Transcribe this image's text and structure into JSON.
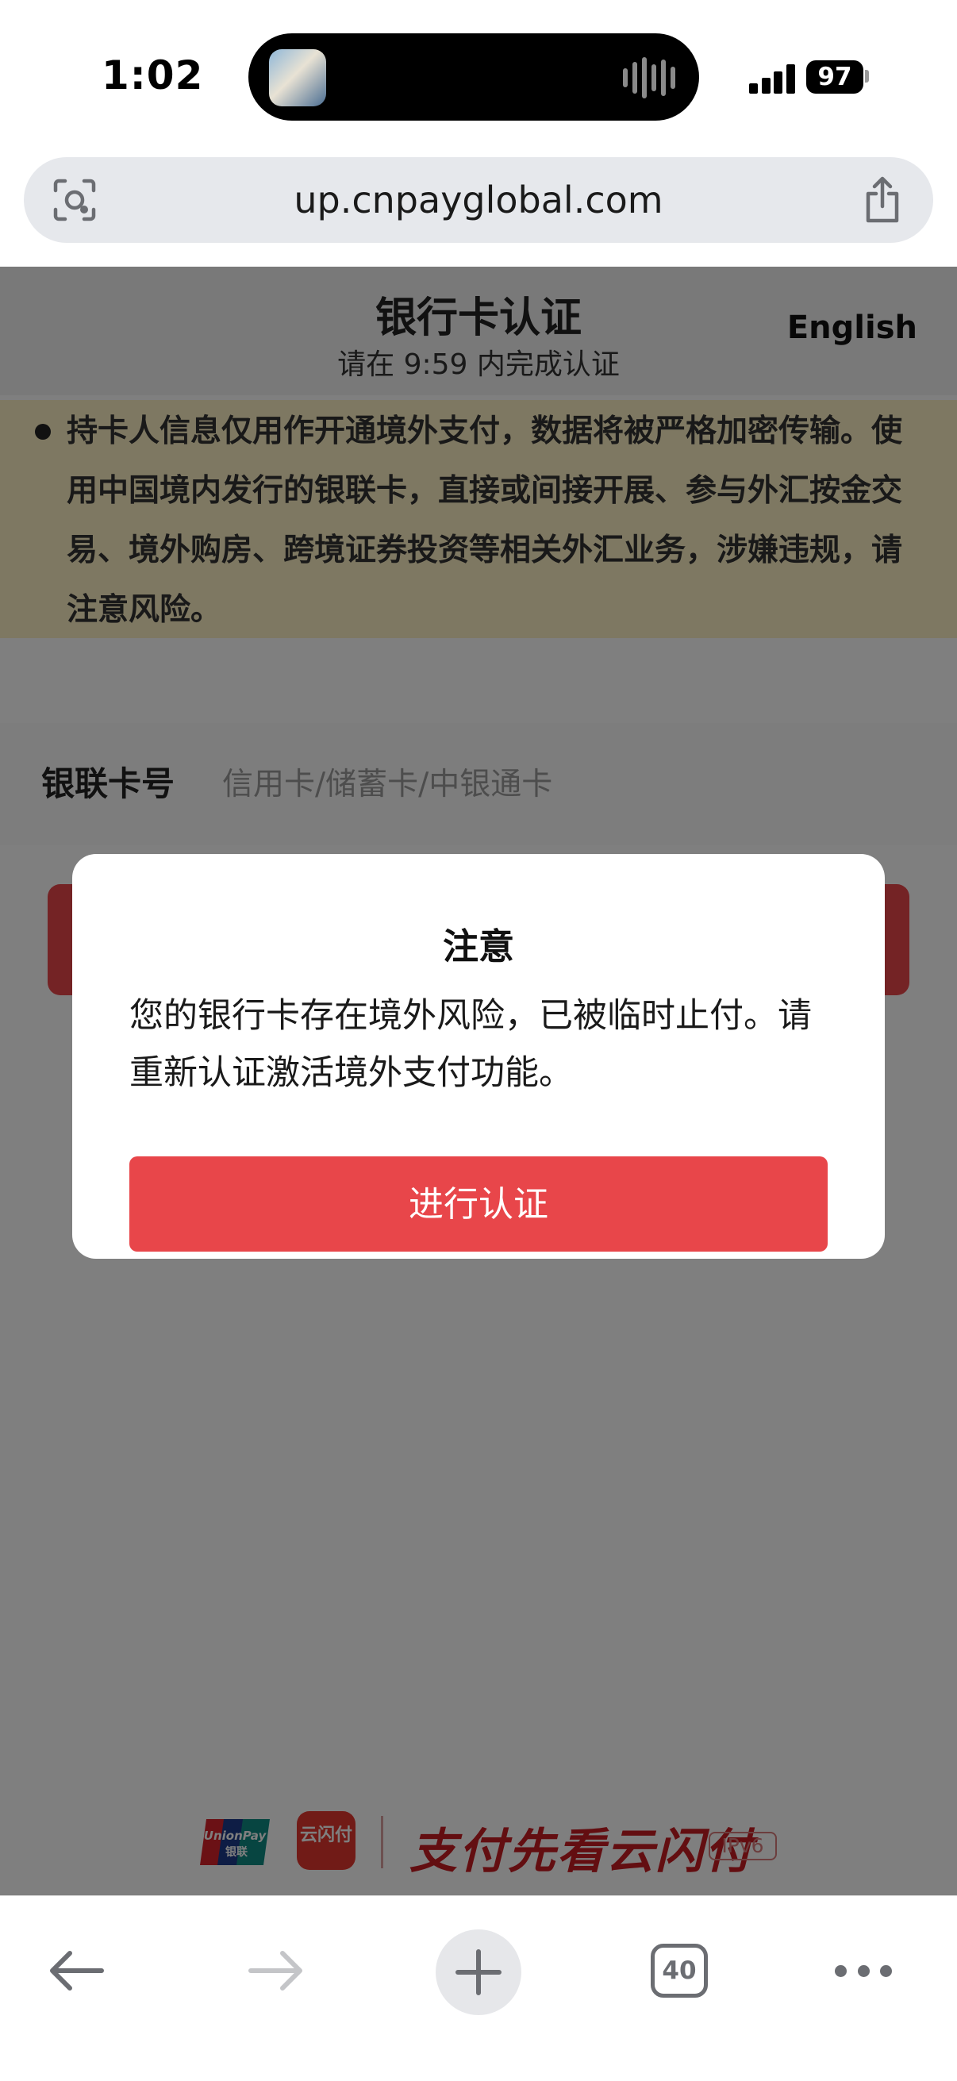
{
  "status_bar": {
    "time": "1:02",
    "battery": "97"
  },
  "browser": {
    "url": "up.cnpayglobal.com",
    "tab_count": "40",
    "icons": {
      "lens": "camera-lens-icon",
      "share": "share-icon",
      "back": "back-arrow-icon",
      "forward": "forward-arrow-icon",
      "new_tab": "plus-icon",
      "tabs": "tabs-icon",
      "more": "more-dots-icon"
    }
  },
  "page": {
    "title": "银行卡认证",
    "subtitle": "请在 9:59 内完成认证",
    "language_link": "English",
    "notice": "持卡人信息仅用作开通境外支付，数据将被严格加密传输。使用中国境内发行的银联卡，直接或间接开展、参与外汇按金交易、境外购房、跨境证券投资等相关外汇业务，涉嫌违规，请注意风险。",
    "card_field": {
      "label": "银联卡号",
      "placeholder": "信用卡/储蓄卡/中银通卡",
      "value": ""
    },
    "footer": {
      "unionpay_logo_text": "UnionPay 银联",
      "cloudpay_logo_text": "云闪付",
      "slogan": "支付先看云闪付",
      "ipv6_badge": "IPv6"
    }
  },
  "modal": {
    "title": "注意",
    "message": "您的银行卡存在境外风险，已被临时止付。请重新认证激活境外支付功能。",
    "button_label": "进行认证"
  },
  "colors": {
    "accent_red": "#e8464a",
    "notice_bg": "#fdf0c4",
    "overlay": "rgba(0,0,0,0.5)"
  }
}
